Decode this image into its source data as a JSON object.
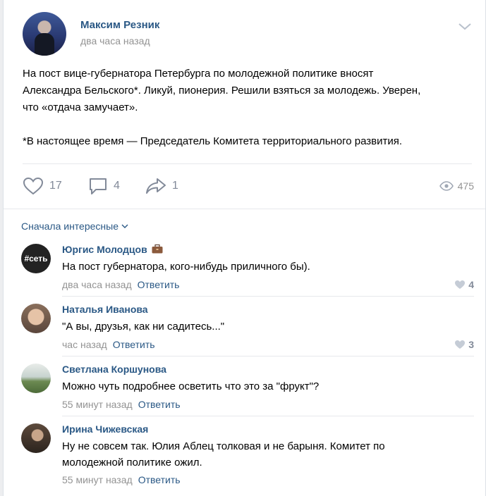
{
  "post": {
    "author": "Максим Резник",
    "time": "два часа назад",
    "text_lines": [
      "На пост вице-губернатора Петербурга по молодежной политике вносят",
      "Александра Бельского*. Ликуй, пионерия. Решили взяться за молодежь. Уверен,",
      "что «отдача замучает»."
    ],
    "footnote": "*В настоящее время — Председатель Комитета территориального развития.",
    "likes": "17",
    "comments": "4",
    "shares": "1",
    "views": "475"
  },
  "sort_label": "Сначала интересные",
  "comments": [
    {
      "name": "Юргис Молодцов",
      "avatar_text": "#сеть",
      "text_lines": [
        "На пост губернатора, кого-нибудь приличного бы)."
      ],
      "time": "два часа назад",
      "reply": "Ответить",
      "likes": "4"
    },
    {
      "name": "Наталья Иванова",
      "text_lines": [
        "\"А вы, друзья, как ни садитесь...\""
      ],
      "time": "час назад",
      "reply": "Ответить",
      "likes": "3"
    },
    {
      "name": "Светлана Коршунова",
      "text_lines": [
        "Можно чуть подробнее осветить что это за \"фрукт\"?"
      ],
      "time": "55 минут назад",
      "reply": "Ответить"
    },
    {
      "name": "Ирина Чижевская",
      "text_lines": [
        "Ну не совсем так. Юлия Аблец толковая и не барыня. Комитет по",
        "молодежной политике ожил."
      ],
      "time": "55 минут назад",
      "reply": "Ответить"
    }
  ],
  "colors": {
    "link": "#2a5885",
    "muted": "#939393",
    "icon": "#828a99",
    "divider": "#e7e8ec"
  }
}
